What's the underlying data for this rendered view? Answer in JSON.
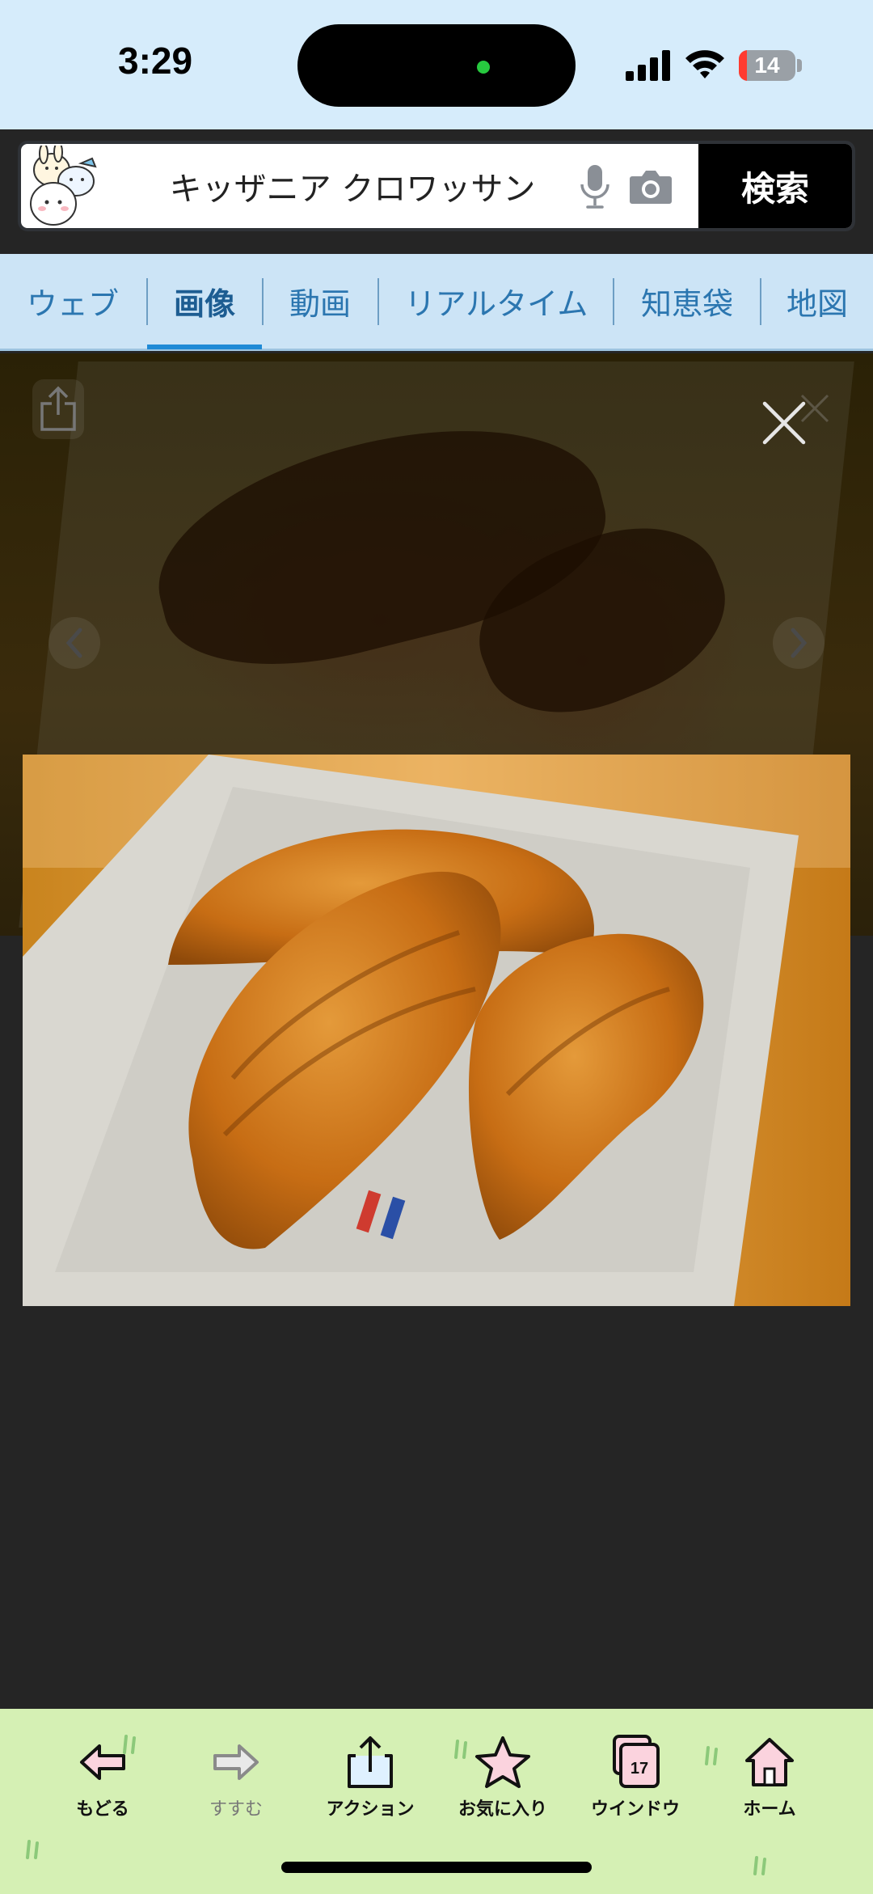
{
  "status_bar": {
    "time": "3:29",
    "battery_level": "14",
    "battery_fraction": 0.14,
    "battery_color": "#ff3b30",
    "icons": [
      "signal-icon",
      "wifi-icon",
      "battery-icon"
    ]
  },
  "search": {
    "query": "キッザニア クロワッサン",
    "button_label": "検索",
    "icons": [
      "mascot-icon",
      "mic-icon",
      "camera-icon"
    ]
  },
  "tabs": [
    {
      "label": "ウェブ",
      "active": false
    },
    {
      "label": "画像",
      "active": true
    },
    {
      "label": "動画",
      "active": false
    },
    {
      "label": "リアルタイム",
      "active": false
    },
    {
      "label": "知恵袋",
      "active": false
    },
    {
      "label": "地図",
      "active": false
    }
  ],
  "viewer": {
    "image_subject": "croissants on paper",
    "icons": [
      "share-icon",
      "close-icon",
      "prev-arrow-icon",
      "next-arrow-icon"
    ]
  },
  "toolbar": {
    "items": [
      {
        "label": "もどる",
        "icon": "back-arrow-icon",
        "enabled": true
      },
      {
        "label": "すすむ",
        "icon": "forward-arrow-icon",
        "enabled": false
      },
      {
        "label": "アクション",
        "icon": "share-icon",
        "enabled": true
      },
      {
        "label": "お気に入り",
        "icon": "star-icon",
        "enabled": true
      },
      {
        "label": "ウインドウ",
        "icon": "windows-icon",
        "enabled": true,
        "count": "17"
      },
      {
        "label": "ホーム",
        "icon": "home-icon",
        "enabled": true
      }
    ]
  },
  "colors": {
    "status_bg": "#d6ecfb",
    "tab_bg": "#cce4f6",
    "tab_text": "#2b76b0",
    "tab_active_underline": "#1f8ad6",
    "viewer_bg": "#252525",
    "toolbar_bg": "#d5f0b4"
  }
}
